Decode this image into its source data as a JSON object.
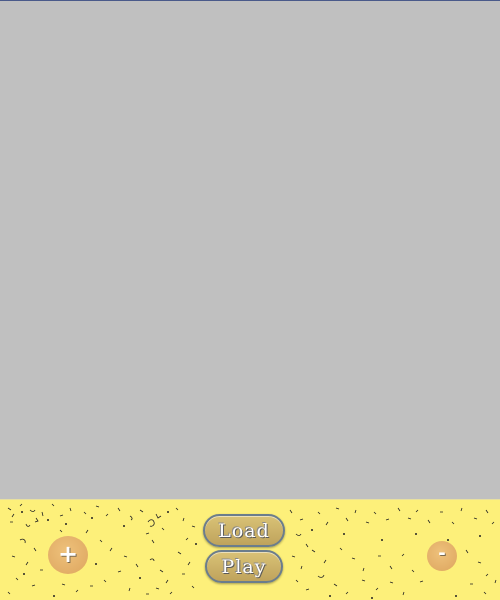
{
  "controls": {
    "load_label": "Load",
    "play_label": "Play",
    "zoom_in_label": "+",
    "zoom_out_label": "-"
  },
  "colors": {
    "canvas_background": "#c0c0c0",
    "control_bar_background": "#fdf07a",
    "button_face": "#cdb46a",
    "round_button_face": "#e6b36c"
  }
}
